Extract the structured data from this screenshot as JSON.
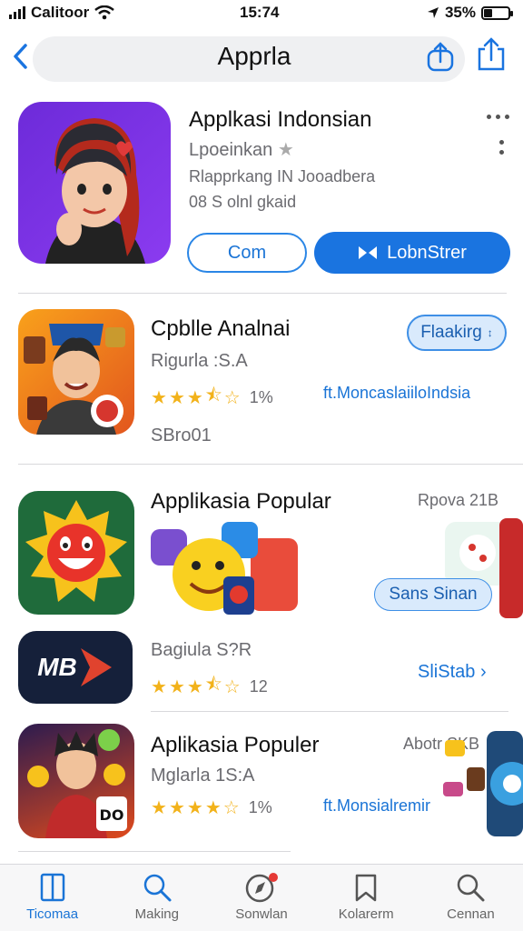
{
  "status_bar": {
    "carrier": "Calitoor",
    "time": "15:74",
    "battery": "35%",
    "battery_level": 0.35
  },
  "nav": {
    "title": "Apprla"
  },
  "featured": {
    "title": "Applkasi Indonsian",
    "subtitle": "Lpoeinkan",
    "description": "Rlapprkang IN Jooadbera",
    "size": "08 S olnl gkaid",
    "button_secondary": "Com",
    "button_primary": "LobnStrer"
  },
  "list": [
    {
      "title": "Cpblle Analnai",
      "developer": "Rigurla :S.A",
      "rating": 3.5,
      "rating_text": "1%",
      "action": "Flaakirg",
      "link": "ft.MoncaslaiiloIndsia",
      "extra": "SBro01"
    },
    {
      "title": "Applikasia Popular",
      "developer": "",
      "rating_text": "",
      "side_text": "Rpova 21B",
      "badge": "Sans Sinan"
    },
    {
      "title": "",
      "developer": "Bagiula S?R",
      "rating": 3.5,
      "rating_text": "12",
      "link": "SliStab",
      "icon_text": "MB"
    },
    {
      "title": "Aplikasia Populer",
      "developer": "Mglarla 1S:A",
      "rating": 4,
      "rating_text": "1%",
      "side_text": "Abotr SKB",
      "link": "ft.Monsialremir",
      "icon_text": "DO"
    }
  ],
  "tabs": [
    {
      "label": "Ticomaa",
      "icon": "book-icon"
    },
    {
      "label": "Making",
      "icon": "search-icon"
    },
    {
      "label": "Sonwlan",
      "icon": "compass-icon"
    },
    {
      "label": "Kolarerm",
      "icon": "bookmark-icon"
    },
    {
      "label": "Cennan",
      "icon": "search-icon"
    }
  ],
  "colors": {
    "accent": "#1a74e0",
    "star": "#f2b21a"
  }
}
